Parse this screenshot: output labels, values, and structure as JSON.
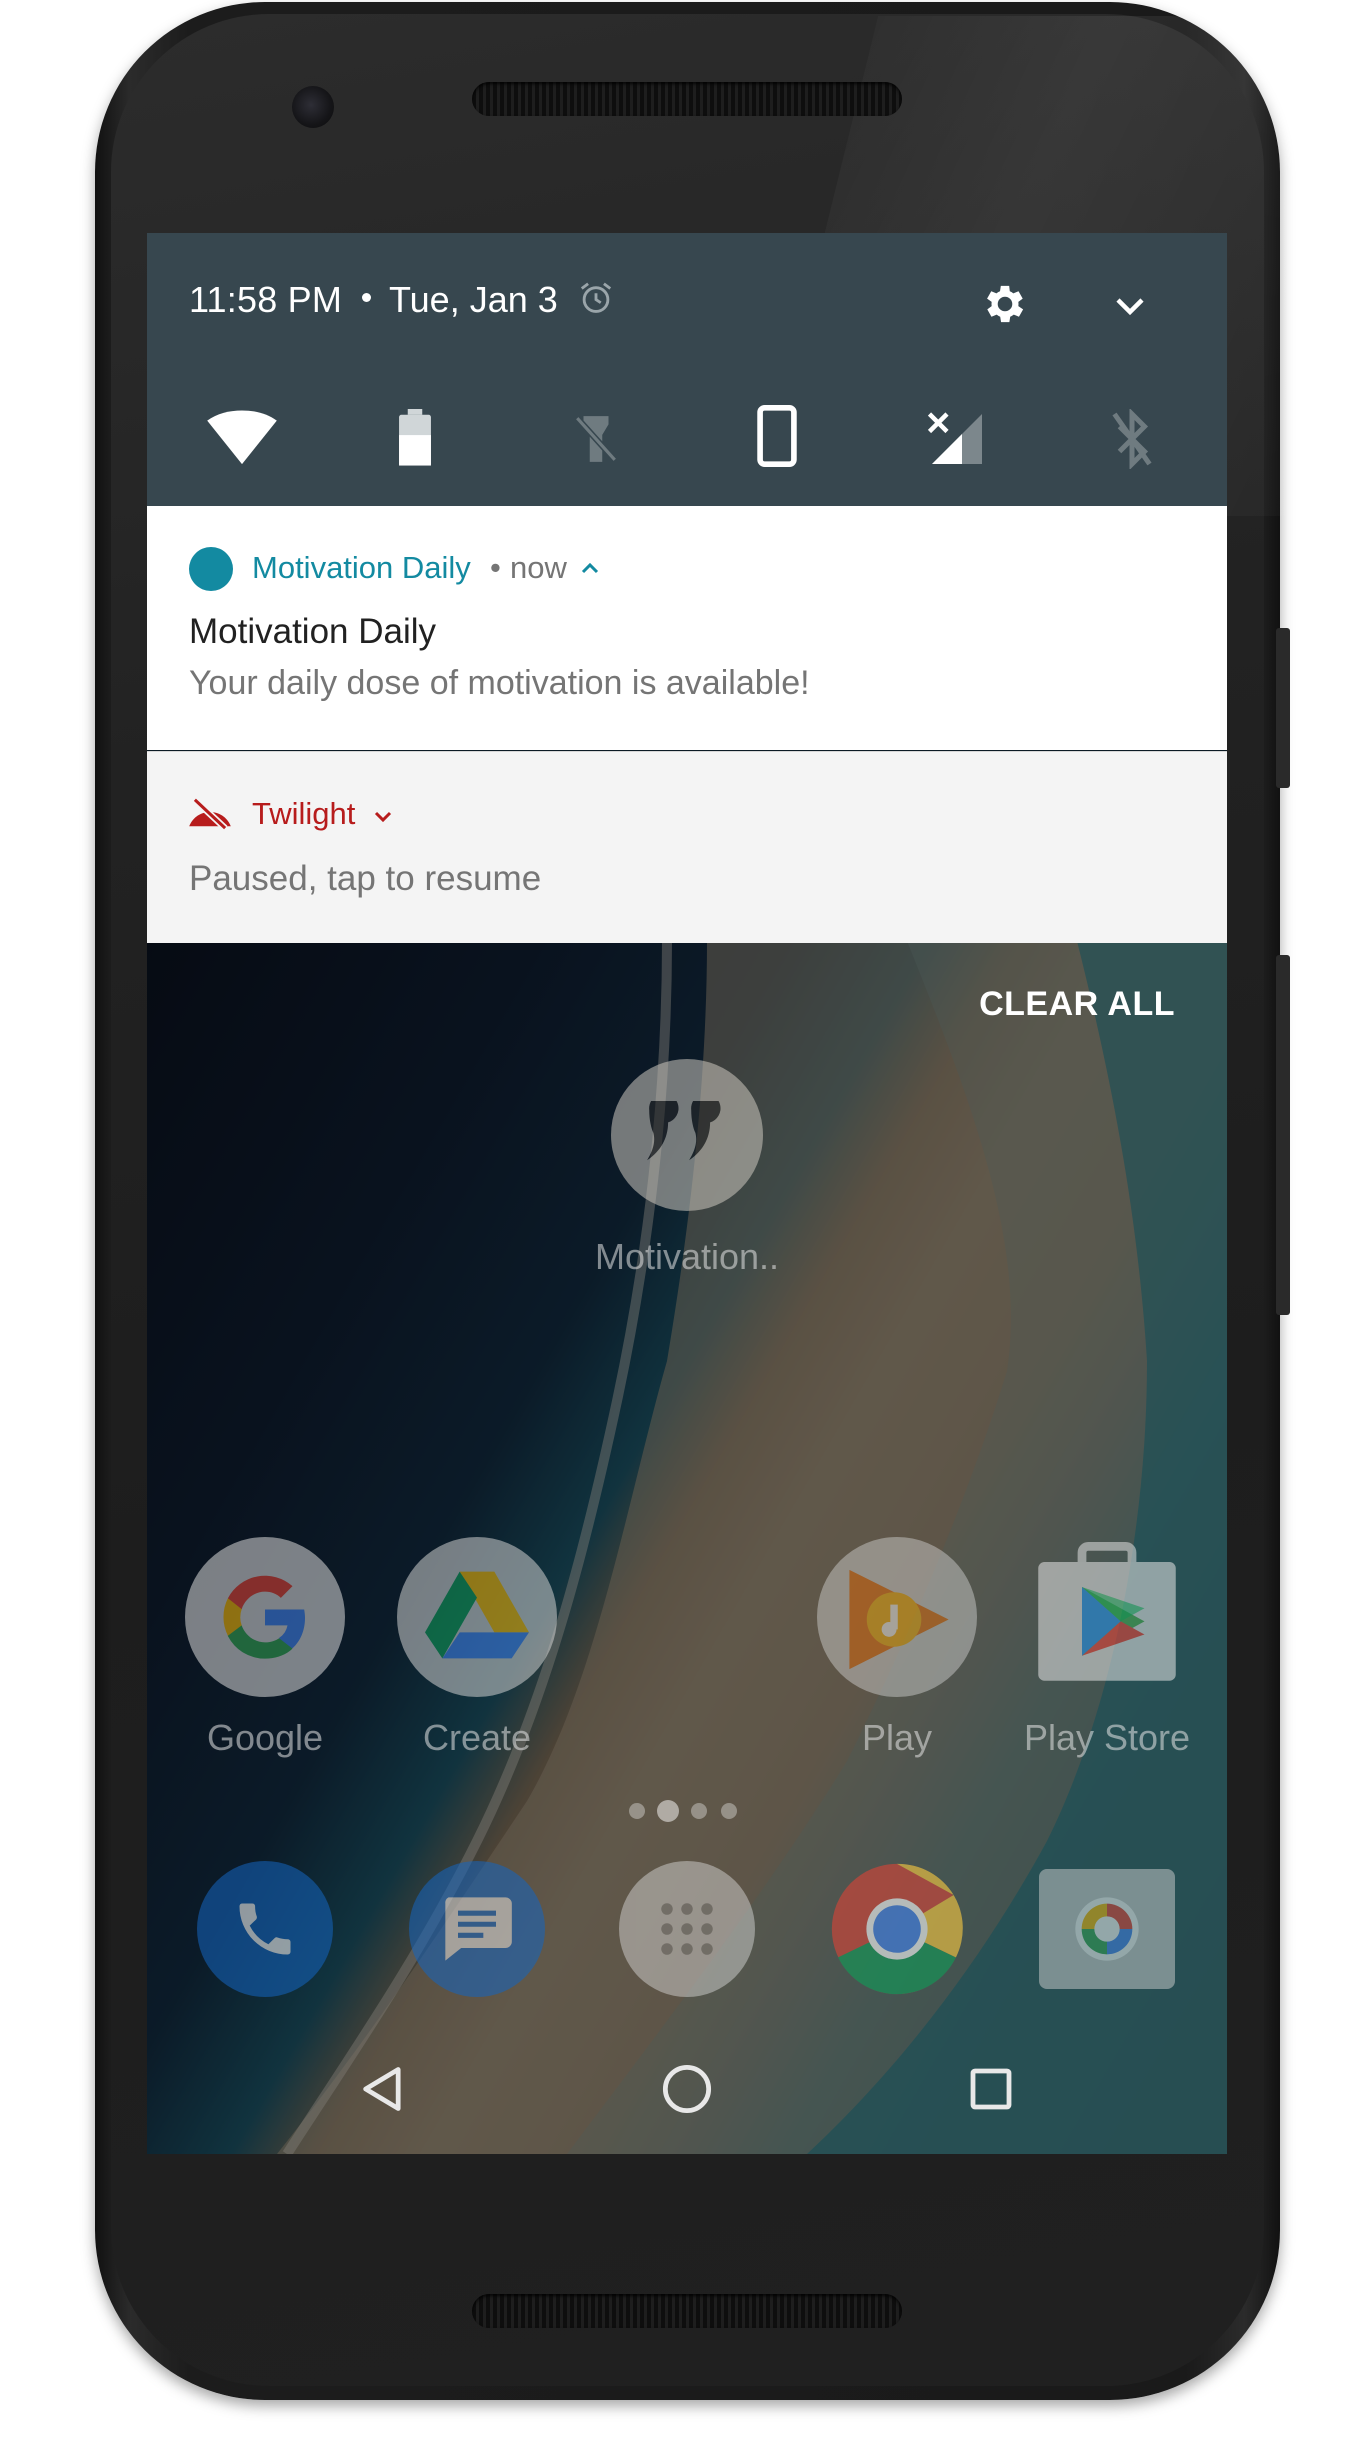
{
  "status": {
    "time": "11:58 PM",
    "date": "Tue, Jan 3"
  },
  "quick_settings": {
    "tiles": [
      {
        "icon": "wifi-icon"
      },
      {
        "icon": "battery-icon"
      },
      {
        "icon": "flashlight-off-icon"
      },
      {
        "icon": "portrait-orientation-icon"
      },
      {
        "icon": "cellular-no-signal-icon"
      },
      {
        "icon": "bluetooth-off-icon"
      }
    ]
  },
  "notifications": [
    {
      "app": "Motivation Daily",
      "separator": "•",
      "time": "now",
      "title": "Motivation Daily",
      "text": "Your daily dose of motivation is available!",
      "accent": "#138aa1"
    },
    {
      "app": "Twilight",
      "text": "Paused, tap to resume",
      "accent": "#b71c1c"
    }
  ],
  "clear_all_label": "CLEAR ALL",
  "home": {
    "widget_label": "Motivation..",
    "apps": [
      {
        "label": "Google"
      },
      {
        "label": "Create"
      },
      {
        "label": "Play"
      },
      {
        "label": "Play Store"
      }
    ],
    "dock": [
      "phone-icon",
      "messages-icon",
      "app-drawer-icon",
      "chrome-icon",
      "camera-icon"
    ]
  },
  "colors": {
    "qs_background": "#37474f",
    "notification_accent": "#138aa1",
    "twilight_accent": "#b71c1c"
  }
}
